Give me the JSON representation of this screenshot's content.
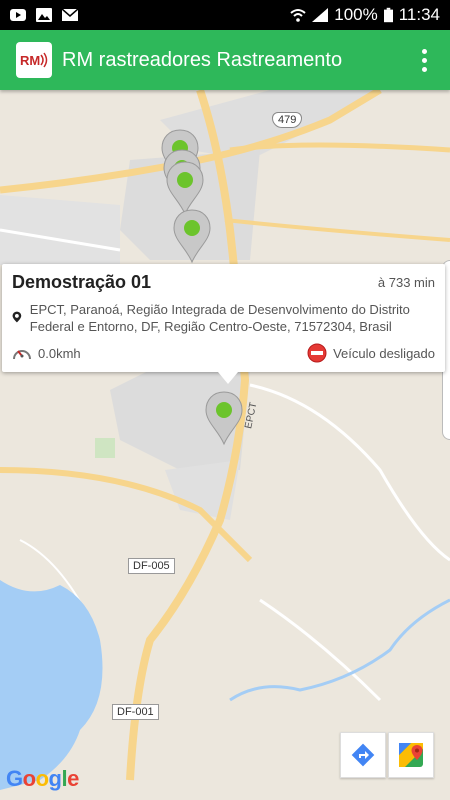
{
  "status_bar": {
    "battery": "100%",
    "time": "11:34",
    "icons": [
      "youtube-icon",
      "image-icon",
      "mail-icon",
      "wifi-icon",
      "signal-icon",
      "battery-icon"
    ]
  },
  "app_bar": {
    "logo_text": "RM",
    "title": "RM rastreadores Rastreamento"
  },
  "map": {
    "road_labels": {
      "shield_479": "479",
      "df_005": "DF-005",
      "df_001": "DF-001",
      "epct": "EPCT"
    }
  },
  "info_window": {
    "title": "Demostração 01",
    "time": "à 733 min",
    "address": "EPCT, Paranoá, Região Integrada de Desenvolvimento do Distrito Federal e Entorno, DF, Região Centro-Oeste, 71572304, Brasil",
    "speed": "0.0kmh",
    "status": "Veículo desligado"
  },
  "attribution": "Google",
  "colors": {
    "app_bar": "#2eb85a",
    "marker_green": "#6cc42c",
    "status_red": "#e53935"
  }
}
